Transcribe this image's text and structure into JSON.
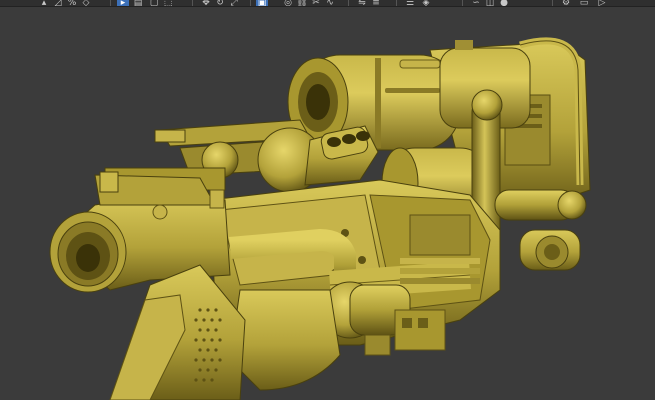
{
  "toolbar": {
    "items": [
      {
        "name": "snap-toggle-icon"
      },
      {
        "name": "angle-snap-icon"
      },
      {
        "name": "percent-snap-icon"
      },
      {
        "name": "spinner-snap-icon"
      },
      {
        "name": "select-object-icon",
        "active": true
      },
      {
        "name": "select-by-name-icon"
      },
      {
        "name": "region-select-icon"
      },
      {
        "name": "window-crossing-icon"
      },
      {
        "name": "move-icon"
      },
      {
        "name": "rotate-icon"
      },
      {
        "name": "scale-icon"
      },
      {
        "name": "reference-coordinate-icon",
        "active": true
      },
      {
        "name": "pivot-center-icon"
      },
      {
        "name": "link-icon"
      },
      {
        "name": "unlink-icon"
      },
      {
        "name": "bind-space-warp-icon"
      },
      {
        "name": "mirror-icon"
      },
      {
        "name": "align-icon"
      },
      {
        "name": "layer-manager-icon"
      },
      {
        "name": "graphite-tools-icon"
      },
      {
        "name": "curve-editor-icon"
      },
      {
        "name": "schematic-view-icon"
      },
      {
        "name": "material-editor-icon"
      },
      {
        "name": "render-setup-icon"
      },
      {
        "name": "render-frame-icon"
      },
      {
        "name": "render-production-icon"
      }
    ]
  },
  "viewport": {
    "model": "steampunk-gun-model",
    "colors": {
      "background": "#3b3b3b",
      "base": "#b3a23a",
      "light": "#d9c95a",
      "dark": "#6b5e18",
      "shadow": "#3a3208",
      "active": "#3c70b8"
    }
  }
}
